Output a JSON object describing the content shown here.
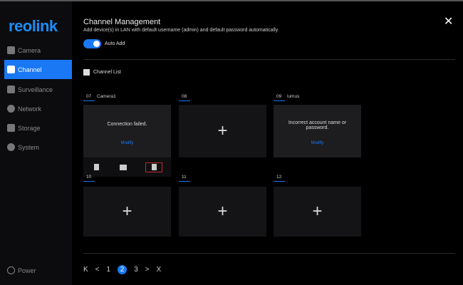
{
  "brand": "reolink",
  "sidebar": {
    "items": [
      {
        "label": "Camera",
        "icon": "camera-icon"
      },
      {
        "label": "Channel",
        "icon": "grid-icon"
      },
      {
        "label": "Surveillance",
        "icon": "list-icon"
      },
      {
        "label": "Network",
        "icon": "globe-icon"
      },
      {
        "label": "Storage",
        "icon": "storage-icon"
      },
      {
        "label": "System",
        "icon": "gear-icon"
      }
    ],
    "active": "Channel",
    "power": "Power"
  },
  "header": {
    "title": "Channel Management",
    "subtitle": "Add device(s) in LAN with default username (admin) and default password automatically.",
    "auto_add": "Auto Add",
    "auto_add_on": true
  },
  "channel_list": {
    "title": "Channel List",
    "channels": [
      {
        "num": "07",
        "name": "Camera1",
        "message": "Connection failed.",
        "action": "Modify"
      },
      {
        "num": "08",
        "name": "",
        "message": "",
        "action": ""
      },
      {
        "num": "09",
        "name": "lumus",
        "message": "Incorrect account name or password.",
        "action": "Modify"
      },
      {
        "num": "10",
        "name": "",
        "message": "",
        "action": ""
      },
      {
        "num": "11",
        "name": "",
        "message": "",
        "action": ""
      },
      {
        "num": "12",
        "name": "",
        "message": "",
        "action": ""
      }
    ]
  },
  "pagination": {
    "pages": [
      "1",
      "2",
      "3"
    ],
    "current": "2",
    "first": "K",
    "prev": "<",
    "next": ">",
    "last": "X"
  },
  "accent": "#1a78f5"
}
